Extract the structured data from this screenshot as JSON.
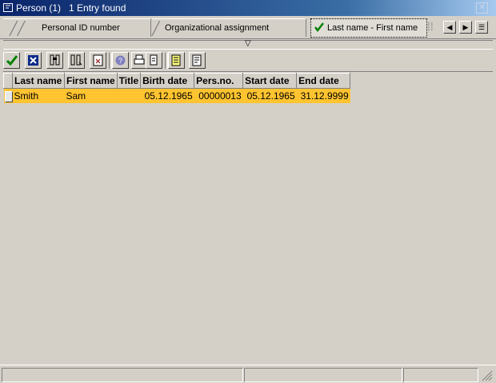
{
  "window": {
    "title": "Person (1)   1 Entry found"
  },
  "tabs": [
    {
      "label": "Personal ID number",
      "active": false
    },
    {
      "label": "Organizational assignment",
      "active": false
    },
    {
      "label": "Last name - First name",
      "active": true
    }
  ],
  "tab_nav": {
    "prev_icon": "arrow-left-icon",
    "next_icon": "arrow-right-icon",
    "list_icon": "tab-list-icon"
  },
  "toolbar": {
    "icons": [
      "check-icon",
      "cancel-icon",
      "find-icon",
      "find-next-icon",
      "attach-icon",
      "help-icon",
      "print-icon",
      "export-icon",
      "layout-icon"
    ]
  },
  "table": {
    "columns": [
      "Last name",
      "First name",
      "Title",
      "Birth date",
      "Pers.no.",
      "Start date",
      "End date"
    ],
    "rows": [
      {
        "last_name": "Smith",
        "first_name": "Sam",
        "title": "",
        "birth_date": "05.12.1965",
        "pers_no": "00000013",
        "start_date": "05.12.1965",
        "end_date": "31.12.9999",
        "selected": true
      }
    ]
  },
  "colors": {
    "selection": "#ffc430",
    "background": "#d4d0c8",
    "titlebar": "#0a246a"
  }
}
